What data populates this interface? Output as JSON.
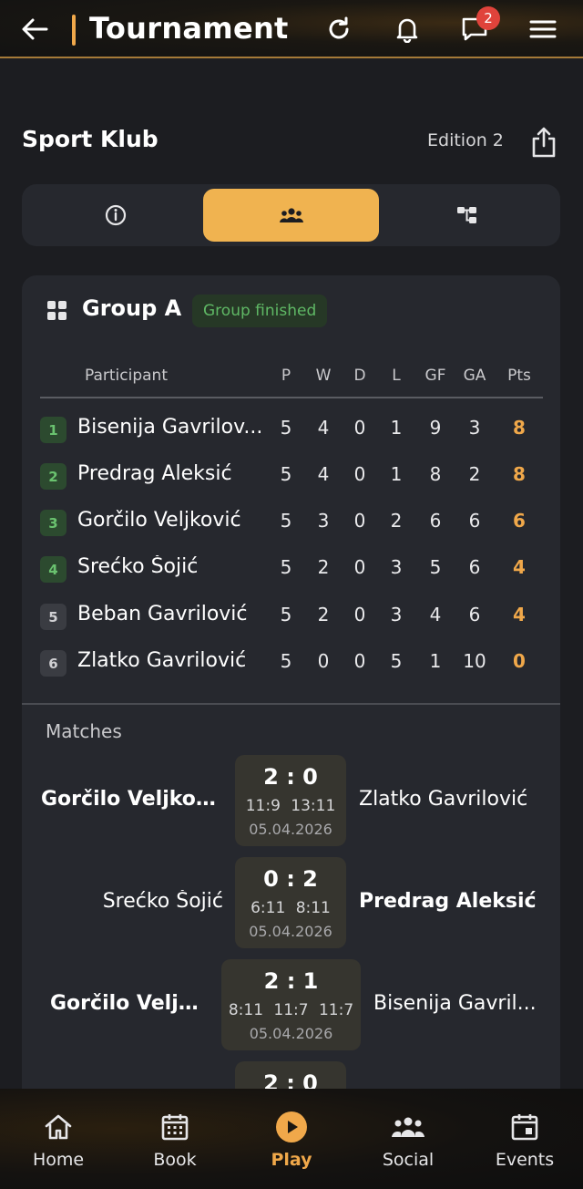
{
  "header": {
    "title": "Tournament",
    "notification_count": "2",
    "icons": [
      "back-arrow-icon",
      "refresh-icon",
      "bell-icon",
      "chat-icon",
      "menu-icon"
    ]
  },
  "event": {
    "club": "Sport Klub",
    "edition": "Edition 2"
  },
  "tabs": [
    {
      "icon": "info-icon",
      "active": false
    },
    {
      "icon": "participants-icon",
      "active": true
    },
    {
      "icon": "bracket-icon",
      "active": false
    }
  ],
  "group": {
    "title": "Group A",
    "status": "Group finished",
    "columns": [
      "Participant",
      "P",
      "W",
      "D",
      "L",
      "GF",
      "GA",
      "Pts"
    ],
    "rows": [
      {
        "rank": "1",
        "name": "Bisenija Gavrilov...",
        "p": "5",
        "w": "4",
        "d": "0",
        "l": "1",
        "gf": "9",
        "ga": "3",
        "pts": "8"
      },
      {
        "rank": "2",
        "name": "Predrag Aleksić",
        "p": "5",
        "w": "4",
        "d": "0",
        "l": "1",
        "gf": "8",
        "ga": "2",
        "pts": "8"
      },
      {
        "rank": "3",
        "name": "Gorčilo Veljković",
        "p": "5",
        "w": "3",
        "d": "0",
        "l": "2",
        "gf": "6",
        "ga": "6",
        "pts": "6"
      },
      {
        "rank": "4",
        "name": "Srećko Šojić",
        "p": "5",
        "w": "2",
        "d": "0",
        "l": "3",
        "gf": "5",
        "ga": "6",
        "pts": "4"
      },
      {
        "rank": "5",
        "name": "Beban Gavrilović",
        "p": "5",
        "w": "2",
        "d": "0",
        "l": "3",
        "gf": "4",
        "ga": "6",
        "pts": "4"
      },
      {
        "rank": "6",
        "name": "Zlatko Gavrilović",
        "p": "5",
        "w": "0",
        "d": "0",
        "l": "5",
        "gf": "1",
        "ga": "10",
        "pts": "0"
      }
    ]
  },
  "matches": {
    "label": "Matches",
    "items": [
      {
        "left": "Gorčilo Veljkov...",
        "right": "Zlatko Gavrilović",
        "score": "2 : 0",
        "sets": "11:9  13:11",
        "date": "05.04.2026"
      },
      {
        "left": "Srećko Šojić",
        "right": "Predrag Aleksić",
        "score": "0 : 2",
        "sets": "6:11  8:11",
        "date": "05.04.2026"
      },
      {
        "left": "Gorčilo Veljk...",
        "right": "Bisenija Gavril...",
        "score": "2 : 1",
        "sets": "8:11  11:7  11:7",
        "date": "05.04.2026"
      },
      {
        "score": "2 : 0"
      }
    ]
  },
  "nav": {
    "items": [
      {
        "label": "Home",
        "icon": "home-icon",
        "active": false
      },
      {
        "label": "Book",
        "icon": "calendar-grid-icon",
        "active": false
      },
      {
        "label": "Play",
        "icon": "play-icon",
        "active": true
      },
      {
        "label": "Social",
        "icon": "people-icon",
        "active": false
      },
      {
        "label": "Events",
        "icon": "event-calendar-icon",
        "active": false
      }
    ]
  },
  "colors": {
    "accent": "#f0a84a",
    "background": "#1c1d21",
    "card": "#26282e",
    "status_green": "#5fb865",
    "badge_red": "#e0433b"
  }
}
